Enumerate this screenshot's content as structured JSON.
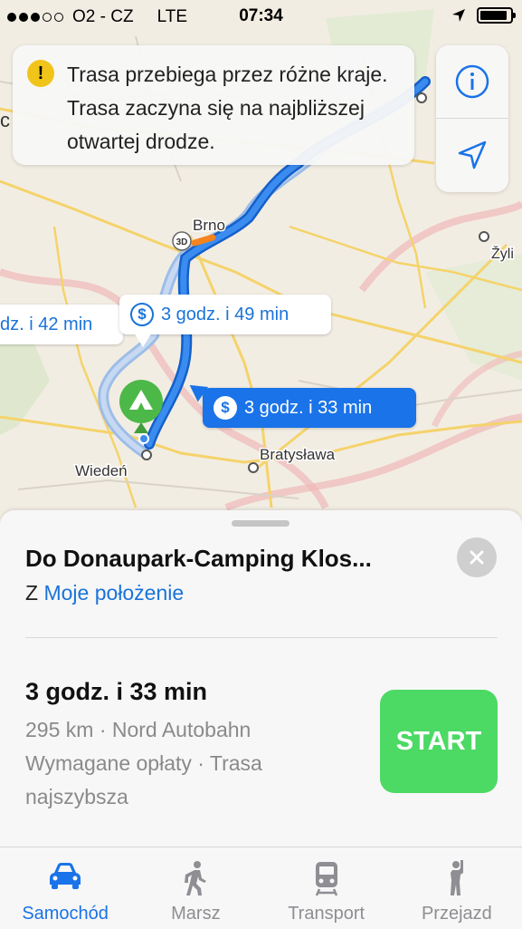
{
  "status_bar": {
    "carrier": "O2 - CZ",
    "network": "LTE",
    "time": "07:34",
    "signal_bars_filled": 3,
    "signal_bars_total": 5,
    "battery_level": 0.9
  },
  "banner": {
    "icon": "warning-icon",
    "text": "Trasa przebiega przez różne kraje. Trasa zaczyna się na najbliższej otwartej drodze."
  },
  "map": {
    "labels": {
      "brno": "Brno",
      "bratislava": "Bratysława",
      "vienna": "Wiedeń",
      "zyli": "Žyli",
      "edge_c": "c",
      "badge_3d": "3D"
    },
    "routes": [
      {
        "label": "dz. i 42 min",
        "selected": false,
        "icon": "dollar-icon"
      },
      {
        "label": "3 godz. i 49 min",
        "selected": false,
        "icon": "dollar-icon"
      },
      {
        "label": "3 godz. i 33 min",
        "selected": true,
        "icon": "dollar-icon"
      }
    ],
    "buttons": {
      "info": "info-icon",
      "location": "location-arrow-icon"
    },
    "colors": {
      "route_selected": "#1a73e8",
      "route_alt": "#8fb4e8",
      "destination_pin": "#4cb848"
    }
  },
  "sheet": {
    "destination": "Do Donaupark-Camping Klos...",
    "from_prefix": "Z",
    "from_link": "Moje położenie",
    "duration": "3 godz. i 33 min",
    "details_line1": "295 km · Nord Autobahn",
    "details_line2": "Wymagane opłaty · Trasa najszybsza",
    "start_label": "START",
    "start_color": "#4cd964"
  },
  "tabs": [
    {
      "label": "Samochód",
      "icon": "car-icon",
      "active": true
    },
    {
      "label": "Marsz",
      "icon": "walking-icon",
      "active": false
    },
    {
      "label": "Transport",
      "icon": "train-icon",
      "active": false
    },
    {
      "label": "Przejazd",
      "icon": "ride-hail-icon",
      "active": false
    }
  ]
}
